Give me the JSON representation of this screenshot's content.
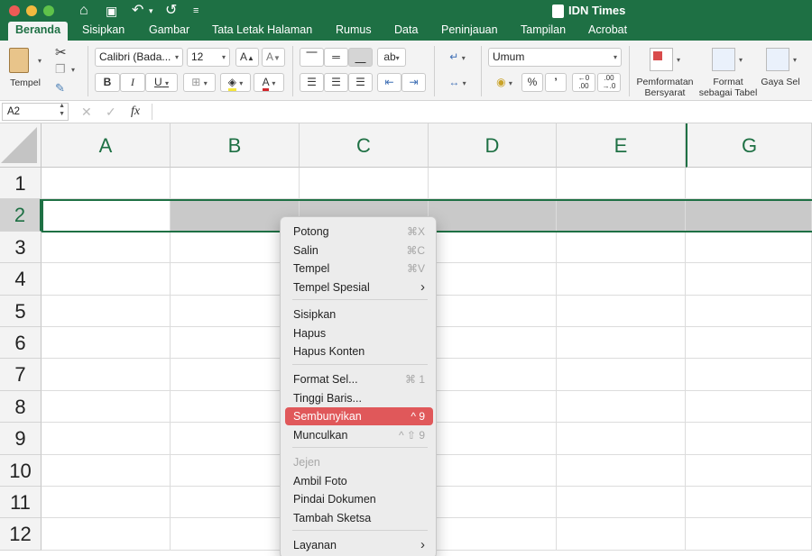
{
  "titlebar": {
    "title": "IDN Times"
  },
  "tabs": [
    "Beranda",
    "Sisipkan",
    "Gambar",
    "Tata Letak Halaman",
    "Rumus",
    "Data",
    "Peninjauan",
    "Tampilan",
    "Acrobat"
  ],
  "ribbon": {
    "paste_label": "Tempel",
    "font_name": "Calibri (Bada...",
    "font_size": "12",
    "bold": "B",
    "italic": "I",
    "underline": "U",
    "number_format": "Umum",
    "percent": "%",
    "comma": "’",
    "cond_format_label": "Pemformatan Bersyarat",
    "format_table_label": "Format sebagai Tabel",
    "cell_style_label": "Gaya Sel"
  },
  "formula": {
    "name_box": "A2",
    "fx": "fx"
  },
  "columns": [
    "A",
    "B",
    "C",
    "D",
    "E",
    "G"
  ],
  "rows": [
    "1",
    "2",
    "3",
    "4",
    "5",
    "6",
    "7",
    "8",
    "9",
    "10",
    "11",
    "12"
  ],
  "context_menu": [
    {
      "label": "Potong",
      "shortcut": "⌘X"
    },
    {
      "label": "Salin",
      "shortcut": "⌘C"
    },
    {
      "label": "Tempel",
      "shortcut": "⌘V"
    },
    {
      "label": "Tempel Spesial",
      "shortcut": "›"
    },
    {
      "label": "Sisipkan",
      "shortcut": ""
    },
    {
      "label": "Hapus",
      "shortcut": ""
    },
    {
      "label": "Hapus Konten",
      "shortcut": ""
    },
    {
      "label": "Format Sel...",
      "shortcut": "⌘ 1"
    },
    {
      "label": "Tinggi Baris...",
      "shortcut": ""
    },
    {
      "label": "Sembunyikan",
      "shortcut": "^ 9"
    },
    {
      "label": "Munculkan",
      "shortcut": "^ ⇧ 9"
    },
    {
      "label": "Jejen",
      "shortcut": ""
    },
    {
      "label": "Ambil Foto",
      "shortcut": ""
    },
    {
      "label": "Pindai Dokumen",
      "shortcut": ""
    },
    {
      "label": "Tambah Sketsa",
      "shortcut": ""
    },
    {
      "label": "Layanan",
      "shortcut": "›"
    }
  ]
}
